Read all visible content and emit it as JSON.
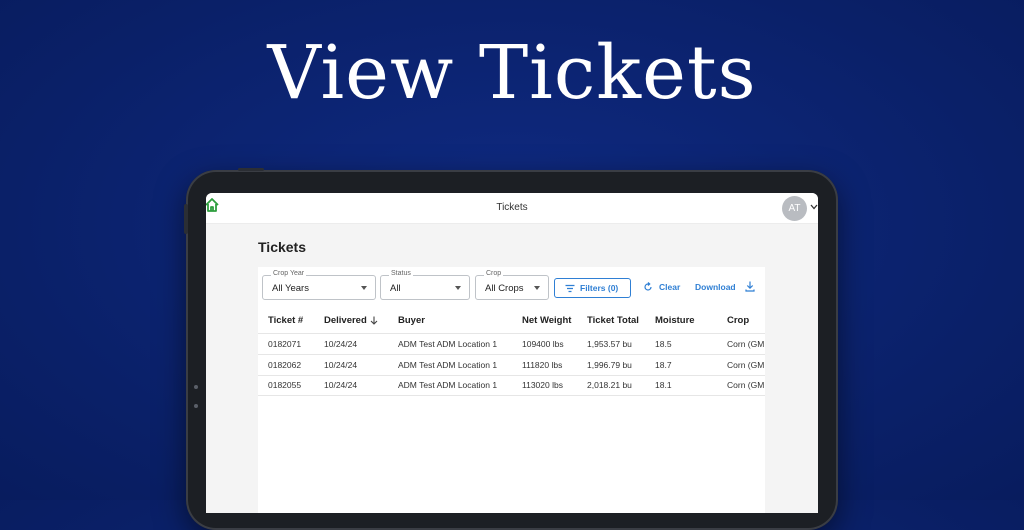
{
  "hero": {
    "title": "View Tickets"
  },
  "topbar": {
    "title": "Tickets",
    "avatar_initials": "AT"
  },
  "page": {
    "title": "Tickets"
  },
  "filters": {
    "crop_year": {
      "label": "Crop Year",
      "value": "All Years"
    },
    "status": {
      "label": "Status",
      "value": "All"
    },
    "crop": {
      "label": "Crop",
      "value": "All Crops"
    },
    "filters_button": "Filters (0)",
    "clear_button": "Clear",
    "download_button": "Download"
  },
  "table": {
    "columns": [
      "Ticket #",
      "Delivered",
      "Buyer",
      "Net Weight",
      "Ticket Total",
      "Moisture",
      "Crop"
    ],
    "rows": [
      [
        "0182071",
        "10/24/24",
        "ADM Test ADM Location 1",
        "109400 lbs",
        "1,953.57 bu",
        "18.5",
        "Corn (GM"
      ],
      [
        "0182062",
        "10/24/24",
        "ADM Test ADM Location 1",
        "111820 lbs",
        "1,996.79 bu",
        "18.7",
        "Corn (GM"
      ],
      [
        "0182055",
        "10/24/24",
        "ADM Test ADM Location 1",
        "113020 lbs",
        "2,018.21 bu",
        "18.1",
        "Corn (GM"
      ]
    ]
  },
  "colors": {
    "background": "#0b2270",
    "accent": "#2f7fd4",
    "home_icon": "#2e9e3e"
  }
}
